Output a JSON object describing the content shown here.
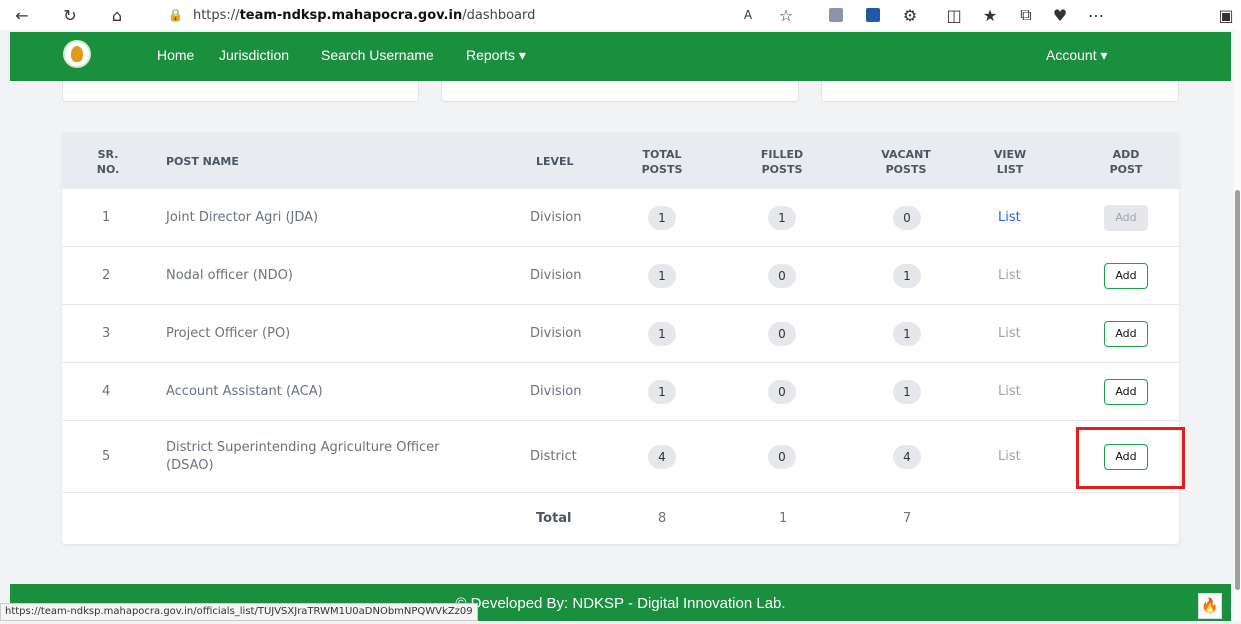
{
  "browser": {
    "url_scheme": "https://",
    "url_host": "team-ndksp.mahapocra.gov.in",
    "url_path": "/dashboard",
    "status_url": "https://team-ndksp.mahapocra.gov.in/officials_list/TUJVSXJraTRWM1U0aDNObmNPQWVkZz09"
  },
  "nav": {
    "home": "Home",
    "jurisdiction": "Jurisdiction",
    "search_username": "Search Username",
    "reports": "Reports ▾",
    "account": "Account ▾"
  },
  "table": {
    "headers": {
      "sr_no": [
        "SR.",
        "NO."
      ],
      "post_name": "POST NAME",
      "level": "LEVEL",
      "total_posts": [
        "TOTAL",
        "POSTS"
      ],
      "filled_posts": [
        "FILLED",
        "POSTS"
      ],
      "vacant_posts": [
        "VACANT",
        "POSTS"
      ],
      "view_list": [
        "VIEW",
        "LIST"
      ],
      "add_post": [
        "ADD",
        "POST"
      ]
    },
    "rows": [
      {
        "sr": "1",
        "name": "Joint Director Agri (JDA)",
        "level": "Division",
        "total": "1",
        "filled": "1",
        "vacant": "0",
        "list": "List",
        "add": "Add"
      },
      {
        "sr": "2",
        "name": "Nodal officer (NDO)",
        "level": "Division",
        "total": "1",
        "filled": "0",
        "vacant": "1",
        "list": "List",
        "add": "Add"
      },
      {
        "sr": "3",
        "name": "Project Officer (PO)",
        "level": "Division",
        "total": "1",
        "filled": "0",
        "vacant": "1",
        "list": "List",
        "add": "Add"
      },
      {
        "sr": "4",
        "name": "Account Assistant (ACA)",
        "level": "Division",
        "total": "1",
        "filled": "0",
        "vacant": "1",
        "list": "List",
        "add": "Add"
      },
      {
        "sr": "5",
        "name_line1": "District Superintending Agriculture Officer",
        "name_line2": "(DSAO)",
        "level": "District",
        "total": "4",
        "filled": "0",
        "vacant": "4",
        "list": "List",
        "add": "Add"
      }
    ],
    "total_label": "Total",
    "total_posts": "8",
    "total_filled": "1",
    "total_vacant": "7"
  },
  "footer": {
    "text": "© Developed By: NDKSP - Digital Innovation Lab."
  },
  "colors": {
    "brand_green": "#1a8f3e",
    "highlight_red": "#e11d1d",
    "link_blue": "#2563eb"
  }
}
